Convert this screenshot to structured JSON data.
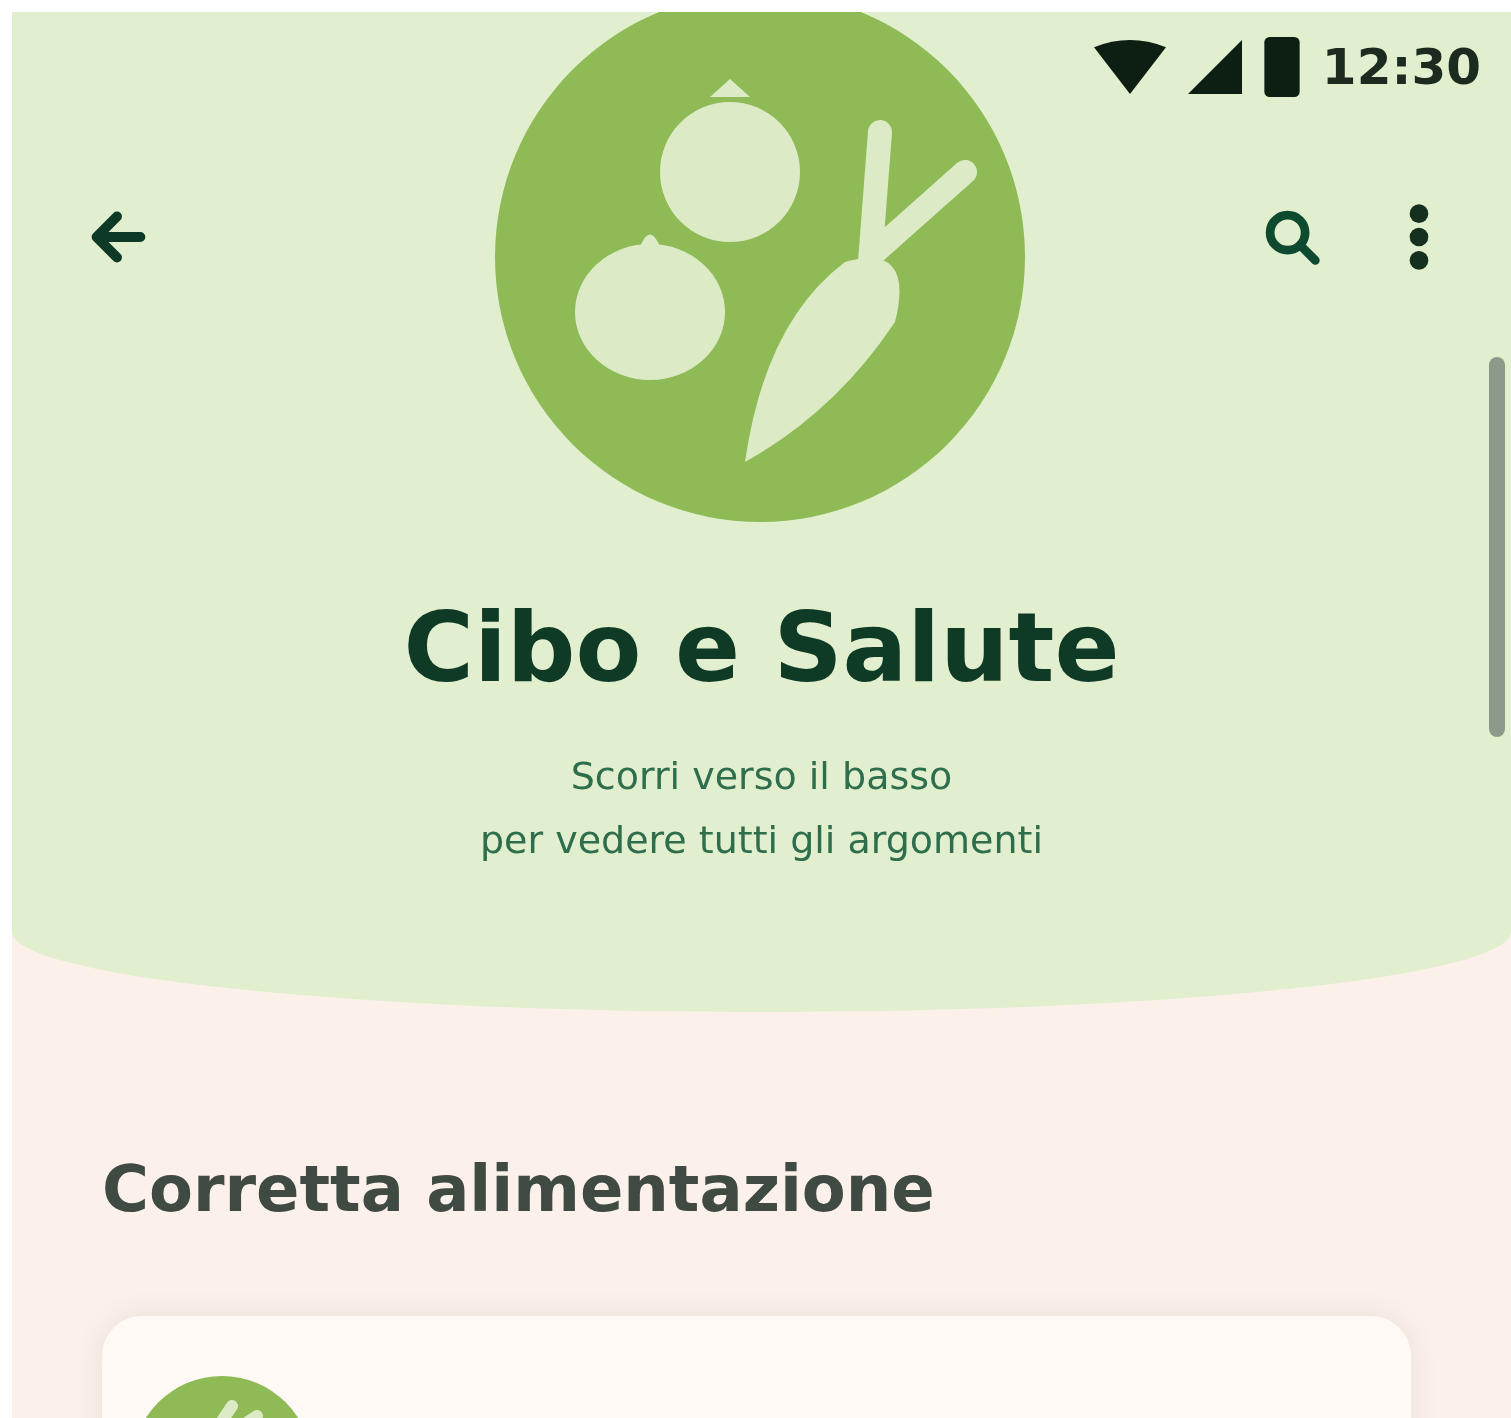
{
  "status_bar": {
    "time": "12:30"
  },
  "header": {
    "title": "Cibo e Salute",
    "subtitle_lines": [
      "Scorri verso il basso",
      "per vedere tutti gli argomenti"
    ]
  },
  "section": {
    "heading": "Corretta alimentazione"
  }
}
